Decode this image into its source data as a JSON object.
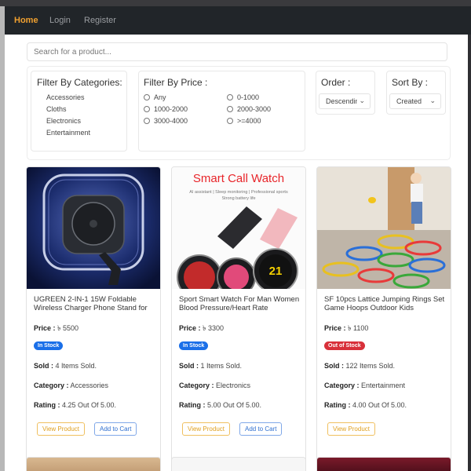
{
  "nav": {
    "items": [
      {
        "label": "Home",
        "active": true
      },
      {
        "label": "Login",
        "active": false
      },
      {
        "label": "Register",
        "active": false
      }
    ]
  },
  "search": {
    "placeholder": "Search for a product..."
  },
  "filters": {
    "categories": {
      "title": "Filter By Categories:",
      "items": [
        "Accessories",
        "Cloths",
        "Electronics",
        "Entertainment"
      ]
    },
    "price": {
      "title": "Filter By Price :",
      "options": [
        "Any",
        "0-1000",
        "1000-2000",
        "2000-3000",
        "3000-4000",
        ">=4000"
      ]
    },
    "order": {
      "title": "Order :",
      "value": "Descending"
    },
    "sort": {
      "title": "Sort By :",
      "value": "Created"
    }
  },
  "labels": {
    "price": "Price :",
    "sold": "Sold :",
    "category": "Category :",
    "rating": "Rating :",
    "view": "View Product",
    "cart": "Add to Cart"
  },
  "products": [
    {
      "title": "UGREEN 2-IN-1 15W Foldable Wireless Charger Phone Stand for",
      "price": "৳ 5500",
      "stock": "In Stock",
      "stock_color": "#1a6fe8",
      "sold": "4 Items Sold.",
      "category": "Accessories",
      "rating": "4.25 Out Of 5.00."
    },
    {
      "title": "Sport Smart Watch For Man Women Blood Pressure/Heart Rate",
      "price": "৳ 3300",
      "stock": "In Stock",
      "stock_color": "#1a6fe8",
      "sold": "1 Items Sold.",
      "category": "Electronics",
      "rating": "5.00 Out Of 5.00.",
      "image_heading": "Smart Call Watch",
      "image_subtext": "AI assistant | Sleep monitoring | Professional sports",
      "image_subtext2": "Strong battery life",
      "watch_number": "21"
    },
    {
      "title": "SF 10pcs Lattice Jumping Rings Set Game Hoops Outdoor Kids",
      "price": "৳ 1100",
      "stock": "Out of Stock",
      "stock_color": "#d8303a",
      "sold": "122 Items Sold.",
      "category": "Entertainment",
      "rating": "4.00 Out Of 5.00."
    }
  ],
  "colors": {
    "accent": "#f0a030",
    "navbar": "#212529",
    "in_stock": "#1a6fe8",
    "out_of_stock": "#d8303a"
  }
}
